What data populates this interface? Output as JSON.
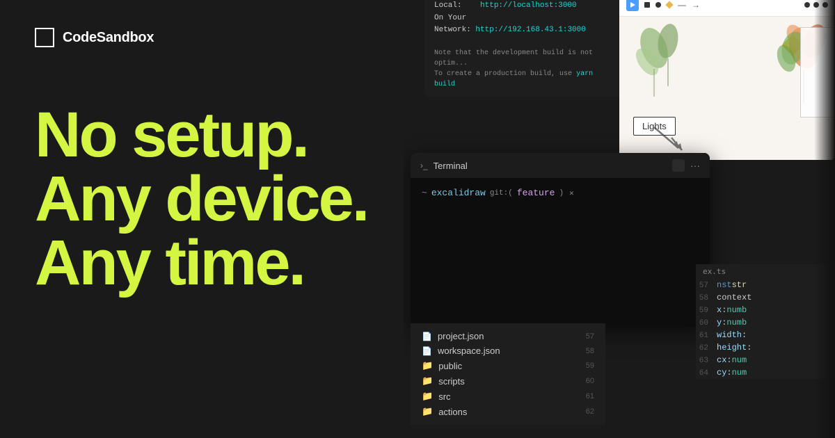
{
  "logo": {
    "text": "CodeSandbox"
  },
  "hero": {
    "line1": "No setup.",
    "line2": "Any device.",
    "line3": "Any time."
  },
  "dev_server": {
    "local_label": "Local:",
    "local_url": "http://localhost:3000",
    "network_label": "On Your Network:",
    "network_url": "http://192.168.43.1:3000",
    "note_line1": "Note that the development build is not optim...",
    "note_line2": "To create a production build, use",
    "note_cmd": "yarn build"
  },
  "terminal": {
    "title": "Terminal",
    "prompt": "~ excalidraw git:(feature) ×"
  },
  "excalidraw": {
    "lights_label": "Lights"
  },
  "file_explorer": {
    "items": [
      {
        "type": "file",
        "name": "project.json",
        "line": 57
      },
      {
        "type": "file",
        "name": "workspace.json",
        "line": 58
      },
      {
        "type": "folder",
        "name": "public",
        "line": 59
      },
      {
        "type": "folder",
        "name": "scripts",
        "line": 60
      },
      {
        "type": "folder",
        "name": "src",
        "line": 61
      },
      {
        "type": "folder",
        "name": "actions",
        "line": 62
      }
    ]
  },
  "code_panel": {
    "filename": "ex.ts",
    "lines": [
      {
        "num": 57,
        "text": "nst str"
      },
      {
        "num": 58,
        "text": "context"
      },
      {
        "num": 59,
        "text": "x: numb"
      },
      {
        "num": 60,
        "text": "y: numb"
      },
      {
        "num": 61,
        "text": "width:"
      },
      {
        "num": 62,
        "text": "height:"
      },
      {
        "num": 63,
        "text": "cx: num"
      },
      {
        "num": 64,
        "text": "cy: num"
      }
    ]
  },
  "actions_label": "actions"
}
